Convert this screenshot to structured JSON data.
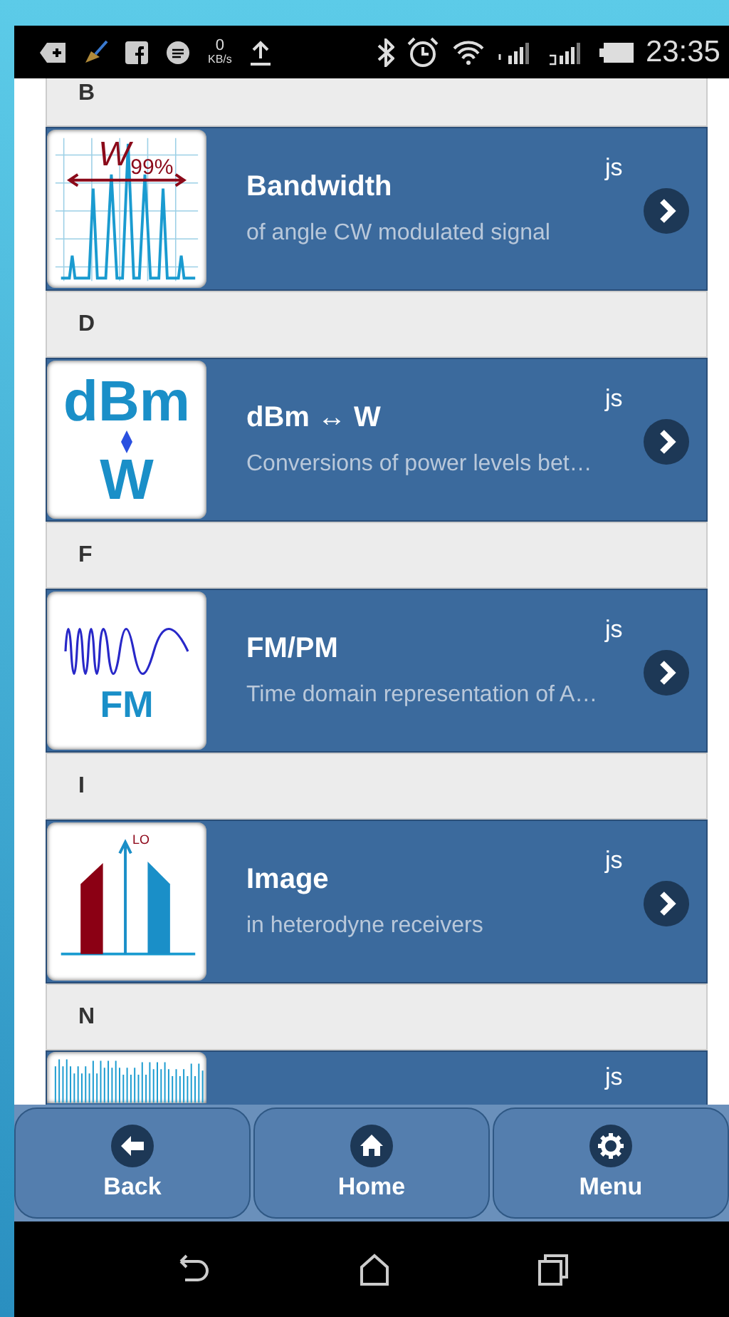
{
  "status_bar": {
    "speed_value": "0",
    "speed_unit": "KB/s",
    "time": "23:35"
  },
  "sections": [
    {
      "letter": "B",
      "items": [
        {
          "title": "Bandwidth",
          "subtitle": "of angle CW modulated signal",
          "tag": "js",
          "thumbnail": {
            "kind": "bandwidth",
            "texts": [
              "*W*$_{99%}$"
            ]
          }
        }
      ]
    },
    {
      "letter": "D",
      "items": [
        {
          "title": "dBm ↔ W",
          "subtitle": "Conversions of power levels bet…",
          "tag": "js",
          "thumbnail": {
            "kind": "dbm",
            "texts": [
              "dBm",
              "W"
            ]
          }
        }
      ]
    },
    {
      "letter": "F",
      "items": [
        {
          "title": "FM/PM",
          "subtitle": "Time domain representation of A…",
          "tag": "js",
          "thumbnail": {
            "kind": "fm",
            "texts": [
              "FM"
            ]
          }
        }
      ]
    },
    {
      "letter": "I",
      "items": [
        {
          "title": "Image",
          "subtitle": "in heterodyne receivers",
          "tag": "js",
          "thumbnail": {
            "kind": "image",
            "texts": [
              "LO"
            ]
          }
        }
      ]
    },
    {
      "letter": "N",
      "items": [
        {
          "tag": "js",
          "thumbnail": {
            "kind": "noise"
          }
        }
      ]
    }
  ],
  "footer": [
    {
      "label": "Back"
    },
    {
      "label": "Home"
    },
    {
      "label": "Menu"
    }
  ]
}
